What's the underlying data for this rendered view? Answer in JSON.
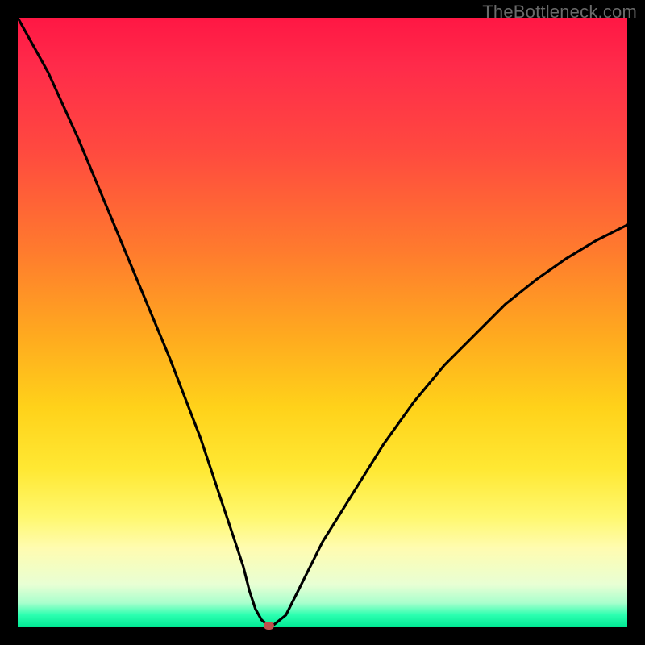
{
  "watermark": "TheBottleneck.com",
  "chart_data": {
    "type": "line",
    "title": "",
    "xlabel": "",
    "ylabel": "",
    "xlim": [
      0,
      100
    ],
    "ylim": [
      0,
      100
    ],
    "grid": false,
    "series": [
      {
        "name": "curve",
        "x": [
          0,
          5,
          10,
          15,
          20,
          25,
          30,
          33,
          35,
          37,
          38,
          39,
          40,
          41,
          41.5,
          42,
          44,
          46,
          50,
          55,
          60,
          65,
          70,
          75,
          80,
          85,
          90,
          95,
          100
        ],
        "y": [
          100,
          91,
          80,
          68,
          56,
          44,
          31,
          22,
          16,
          10,
          6,
          3,
          1.2,
          0.4,
          0.3,
          0.4,
          2,
          6,
          14,
          22,
          30,
          37,
          43,
          48,
          53,
          57,
          60.5,
          63.5,
          66
        ]
      }
    ],
    "marker": {
      "x": 41.2,
      "y": 0.3
    },
    "colors": {
      "curve": "#000000",
      "marker": "#c1504d"
    }
  }
}
